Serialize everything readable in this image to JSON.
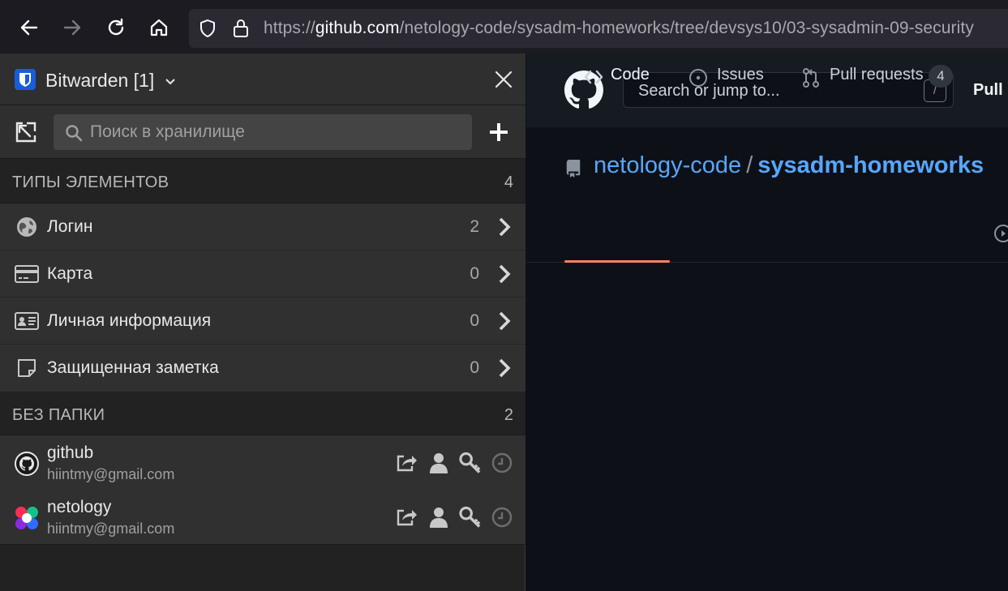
{
  "browser": {
    "url_domain": "github.com",
    "url_prefix": "https://",
    "url_path": "/netology-code/sysadm-homeworks/tree/devsys10/03-sysadmin-09-security"
  },
  "sidebar": {
    "title": "Bitwarden [1]",
    "search_placeholder": "Поиск в хранилище",
    "types_section": {
      "title": "ТИПЫ ЭЛЕМЕНТОВ",
      "count": "4"
    },
    "types": [
      {
        "label": "Логин",
        "count": "2",
        "icon": "globe-icon"
      },
      {
        "label": "Карта",
        "count": "0",
        "icon": "credit-card-icon"
      },
      {
        "label": "Личная информация",
        "count": "0",
        "icon": "id-card-icon"
      },
      {
        "label": "Защищенная заметка",
        "count": "0",
        "icon": "note-icon"
      }
    ],
    "folder_section": {
      "title": "БЕЗ ПАПКИ",
      "count": "2"
    },
    "items": [
      {
        "name": "github",
        "username": "hiintmy@gmail.com",
        "icon": "github-favicon"
      },
      {
        "name": "netology",
        "username": "hiintmy@gmail.com",
        "icon": "netology-favicon"
      }
    ]
  },
  "github": {
    "search_placeholder": "Search or jump to...",
    "search_shortcut": "/",
    "nav_pull": "Pull r",
    "repo_owner": "netology-code",
    "repo_separator": "/",
    "repo_name": "sysadm-homeworks",
    "tabs": [
      {
        "label": "Code",
        "icon": "code-icon"
      },
      {
        "label": "Issues",
        "icon": "issue-icon"
      },
      {
        "label": "Pull requests",
        "icon": "pull-request-icon",
        "count": "4"
      }
    ],
    "colors": {
      "link": "#58a6ff",
      "tab_underline": "#f78166"
    }
  }
}
